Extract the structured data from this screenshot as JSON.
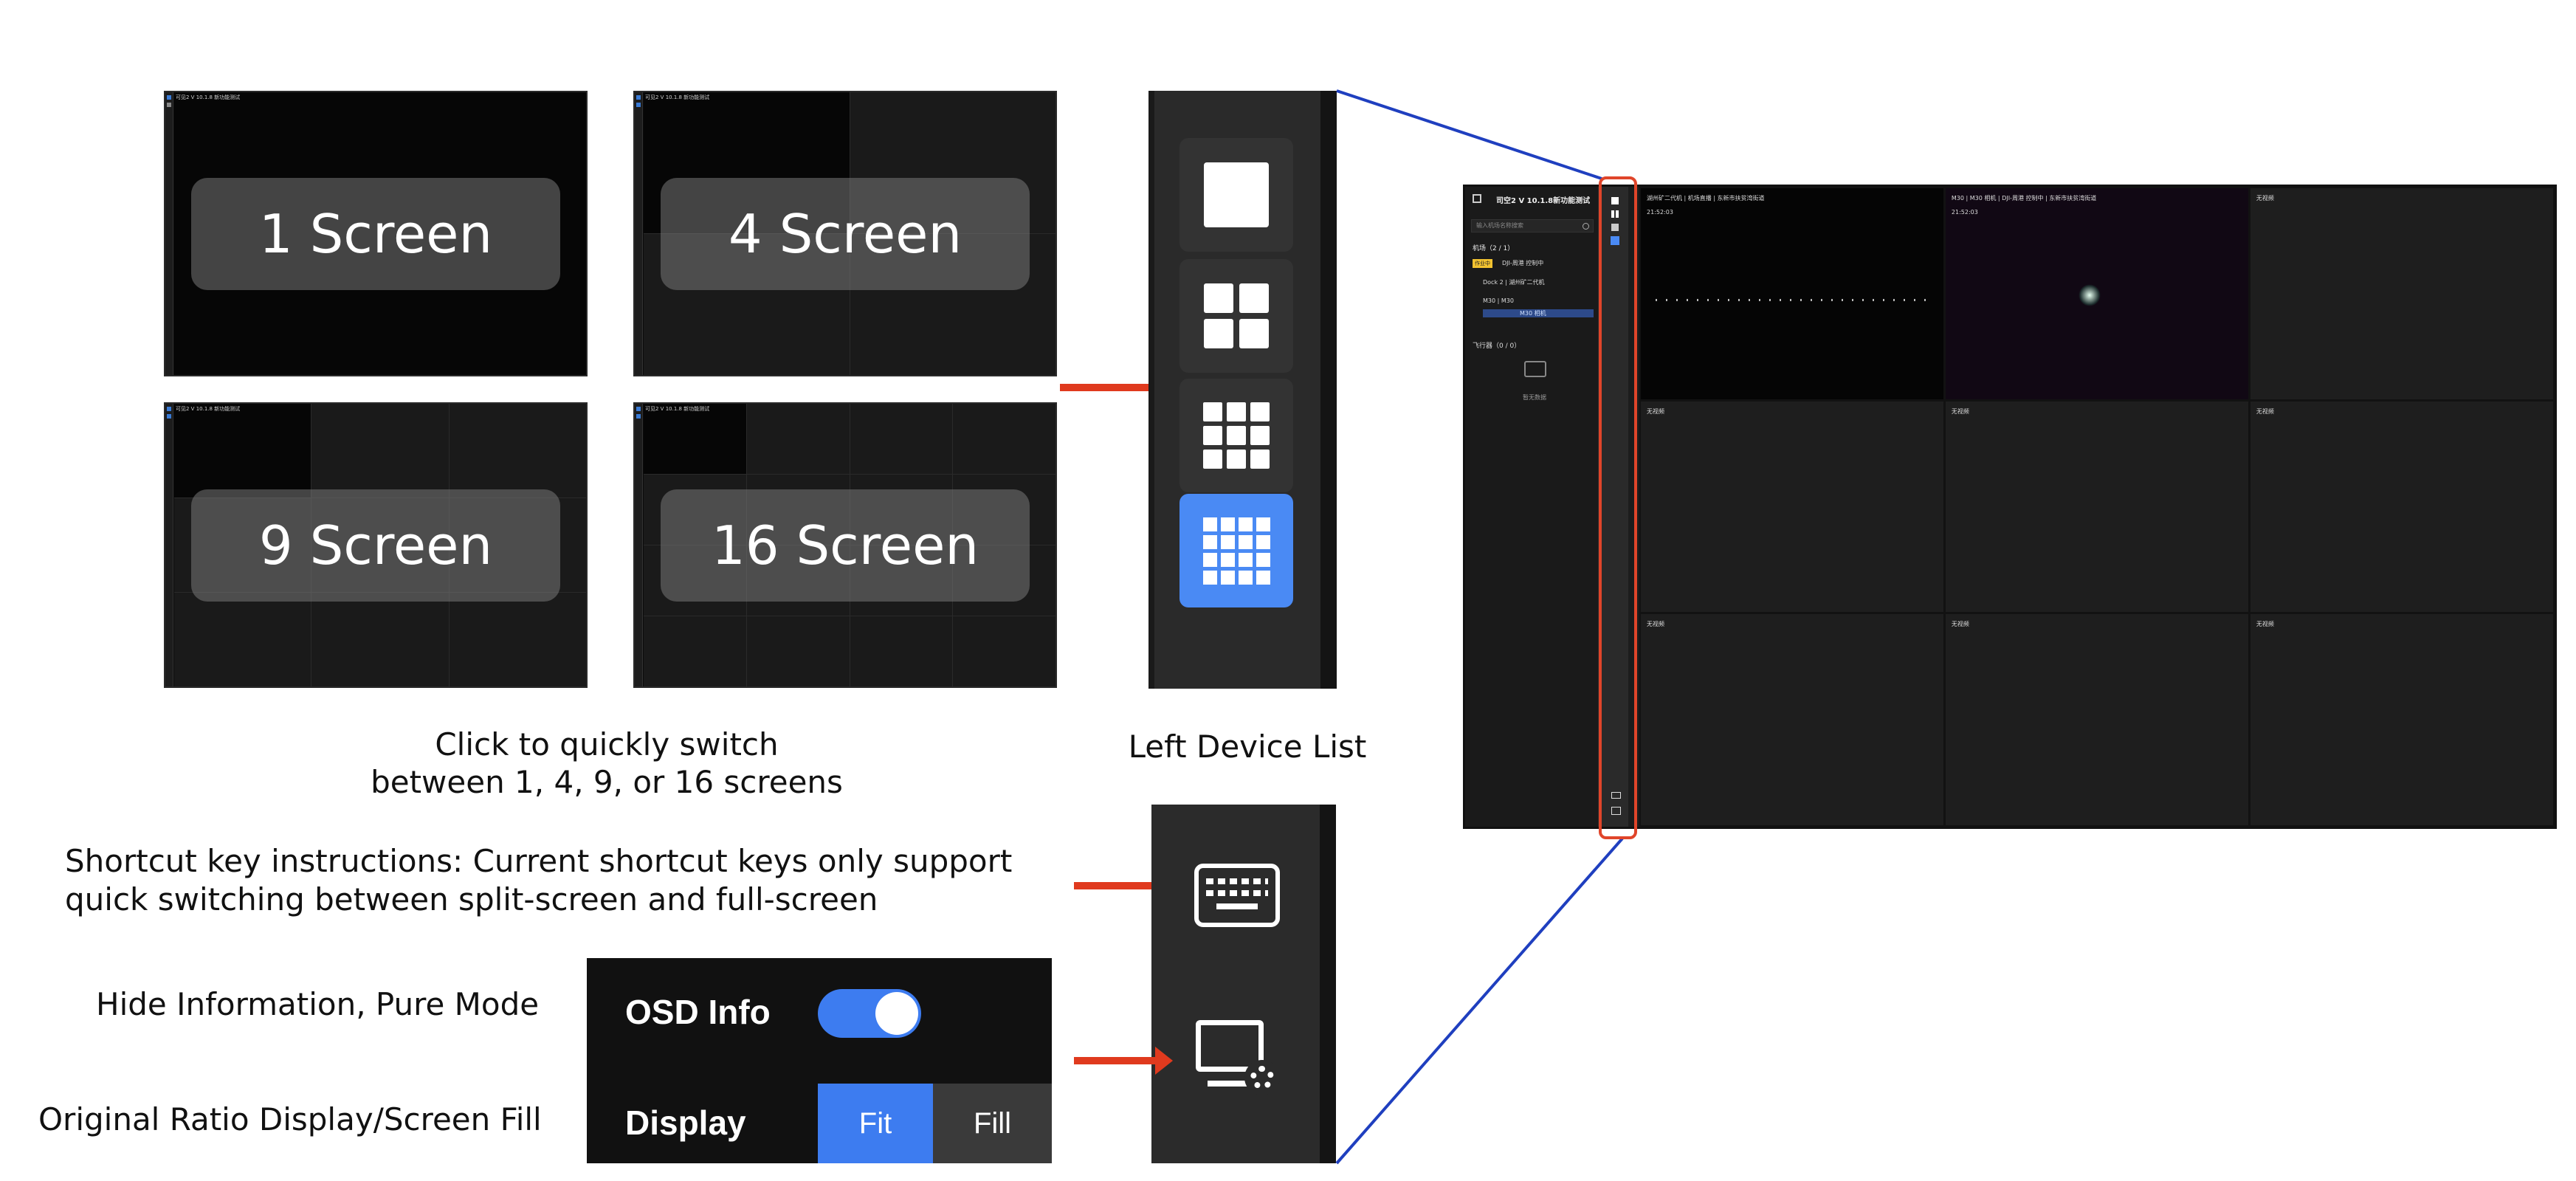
{
  "layouts": {
    "thumbs": [
      {
        "label": "1 Screen",
        "caption": "可见2 V 10.1.8 新功能测试"
      },
      {
        "label": "4 Screen",
        "caption": "可见2 V 10.1.8 新功能测试"
      },
      {
        "label": "9 Screen",
        "caption": "可见2 V 10.1.8 新功能测试"
      },
      {
        "label": "16 Screen",
        "caption": "可见2 V 10.1.8 新功能测试"
      }
    ],
    "caption_line1": "Click to quickly switch",
    "caption_line2": "between 1, 4, 9, or 16 screens"
  },
  "toolbar_zoom": {
    "caption": "Left Device List",
    "buttons": [
      {
        "icon": "single-screen-icon"
      },
      {
        "icon": "four-screen-icon"
      },
      {
        "icon": "nine-screen-icon"
      },
      {
        "icon": "sixteen-screen-icon",
        "active": true
      }
    ]
  },
  "shortcut": {
    "line1": "Shortcut key instructions: Current shortcut keys only support",
    "line2": "quick switching between split-screen and full-screen",
    "icon": "keyboard-icon"
  },
  "display_settings": {
    "hide_info_label": "Hide Information, Pure Mode",
    "ratio_label": "Original Ratio Display/Screen Fill",
    "osd_label": "OSD Info",
    "osd_on": true,
    "display_label": "Display",
    "options": [
      "Fit",
      "Fill"
    ],
    "selected": "Fit",
    "icon": "monitor-settings-icon"
  },
  "app": {
    "title": "司空2 V 10.1.8新功能测试",
    "search_placeholder": "输入机场名称搜索",
    "dock_section": "机场（2 / 1）",
    "status_badge": "作业中",
    "status_text": "DJI-周港 控制中",
    "dock_name": "Dock 2 | 湖州矿二代机",
    "drone_name": "M30 | M30",
    "drone_sub": "M30 相机",
    "aircraft_section": "飞行器（0 / 0）",
    "empty_text": "暂无数据",
    "cells": [
      {
        "title": "湖州矿二代机 | 机场直播 | 东新市扶贫湾街道",
        "time": "21:52:03",
        "video": true
      },
      {
        "title": "M30 | M30 相机 | DJI-周港 控制中 | 东新市扶贫湾街道",
        "time": "21:52:03",
        "video": true
      },
      {
        "title": "无视频",
        "time": "",
        "video": false
      },
      {
        "title": "无视频",
        "time": "",
        "video": false
      },
      {
        "title": "无视频",
        "time": "",
        "video": false
      },
      {
        "title": "无视频",
        "time": "",
        "video": false
      },
      {
        "title": "无视频",
        "time": "",
        "video": false
      },
      {
        "title": "无视频",
        "time": "",
        "video": false
      },
      {
        "title": "无视频",
        "time": "",
        "video": false
      }
    ]
  },
  "colors": {
    "accent_blue": "#3d7cf0",
    "arrow_red": "#e03a1e",
    "highlight_border": "#e0452a",
    "connector_blue": "#1f3fbf",
    "badge_yellow": "#f2c230"
  }
}
